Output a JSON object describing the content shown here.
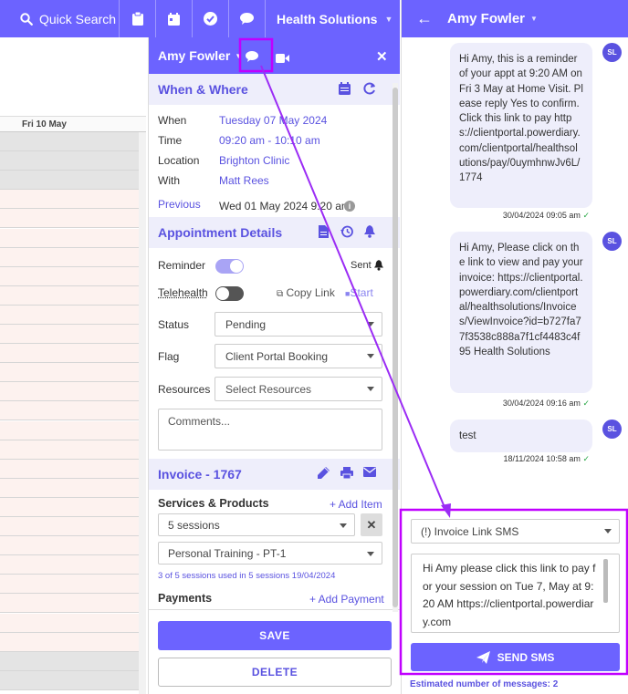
{
  "topbar": {
    "search_label": "Quick Search",
    "app_name": "Health Solutions"
  },
  "calendar": {
    "day_header": "Fri 10 May"
  },
  "appointment": {
    "client_name": "Amy Fowler",
    "when_where": {
      "title": "When & Where",
      "when_label": "When",
      "when_value": "Tuesday 07 May 2024",
      "time_label": "Time",
      "time_value": "09:20 am - 10:10 am",
      "location_label": "Location",
      "location_value": "Brighton Clinic",
      "with_label": "With",
      "with_value": "Matt Rees",
      "previous_label": "Previous",
      "previous_value": "Wed 01 May 2024 9:20 am"
    },
    "details": {
      "title": "Appointment Details",
      "reminder_label": "Reminder",
      "reminder_on": true,
      "sent_label": "Sent",
      "telehealth_label": "Telehealth",
      "telehealth_on": false,
      "copy_link_label": "Copy Link",
      "start_label": "Start",
      "status_label": "Status",
      "status_value": "Pending",
      "flag_label": "Flag",
      "flag_value": "Client Portal Booking",
      "resources_label": "Resources",
      "resources_placeholder": "Select Resources",
      "comments_placeholder": "Comments..."
    },
    "invoice": {
      "title": "Invoice - 1767",
      "services_label": "Services & Products",
      "add_item_label": "+ Add Item",
      "sessions_value": "5 sessions",
      "service_value": "Personal Training - PT-1",
      "sessions_note": "3 of 5 sessions used in 5 sessions 19/04/2024",
      "payments_label": "Payments",
      "add_payment_label": "+ Add Payment"
    },
    "save_label": "SAVE",
    "delete_label": "DELETE"
  },
  "sms": {
    "client_name": "Amy Fowler",
    "avatar_initials": "SL",
    "messages": [
      {
        "text": "Hi Amy, this is a reminder of your appt at 9:20 AM on Fri 3 May at Home Visit. Please reply Yes to confirm. Click this link to pay https://clientportal.powerdiary.com/clientportal/healthsolutions/pay/0uymhnwJv6L/1774",
        "timestamp": "30/04/2024 09:05 am"
      },
      {
        "text": "Hi Amy, Please click on the link to view and pay your invoice: https://clientportal.powerdiary.com/clientportal/healthsolutions/Invoices/ViewInvoice?id=b727fa77f3538c888a7f1cf4483c4f95 Health Solutions",
        "timestamp": "30/04/2024 09:16 am"
      },
      {
        "text": "test",
        "timestamp": "18/11/2024 10:58 am"
      }
    ],
    "template_value": "(!) Invoice Link SMS",
    "compose_text": "Hi Amy please click this link to pay for your session on Tue 7, May at 9:20 AM https://clientportal.powerdiary.com",
    "send_label": "SEND SMS",
    "estimate_label": "Estimated number of messages: 2"
  },
  "colors": {
    "accent": "#6c63ff",
    "accent_text": "#5a52e0",
    "highlight": "#c000ff",
    "arrow": "#9b2cf5"
  }
}
